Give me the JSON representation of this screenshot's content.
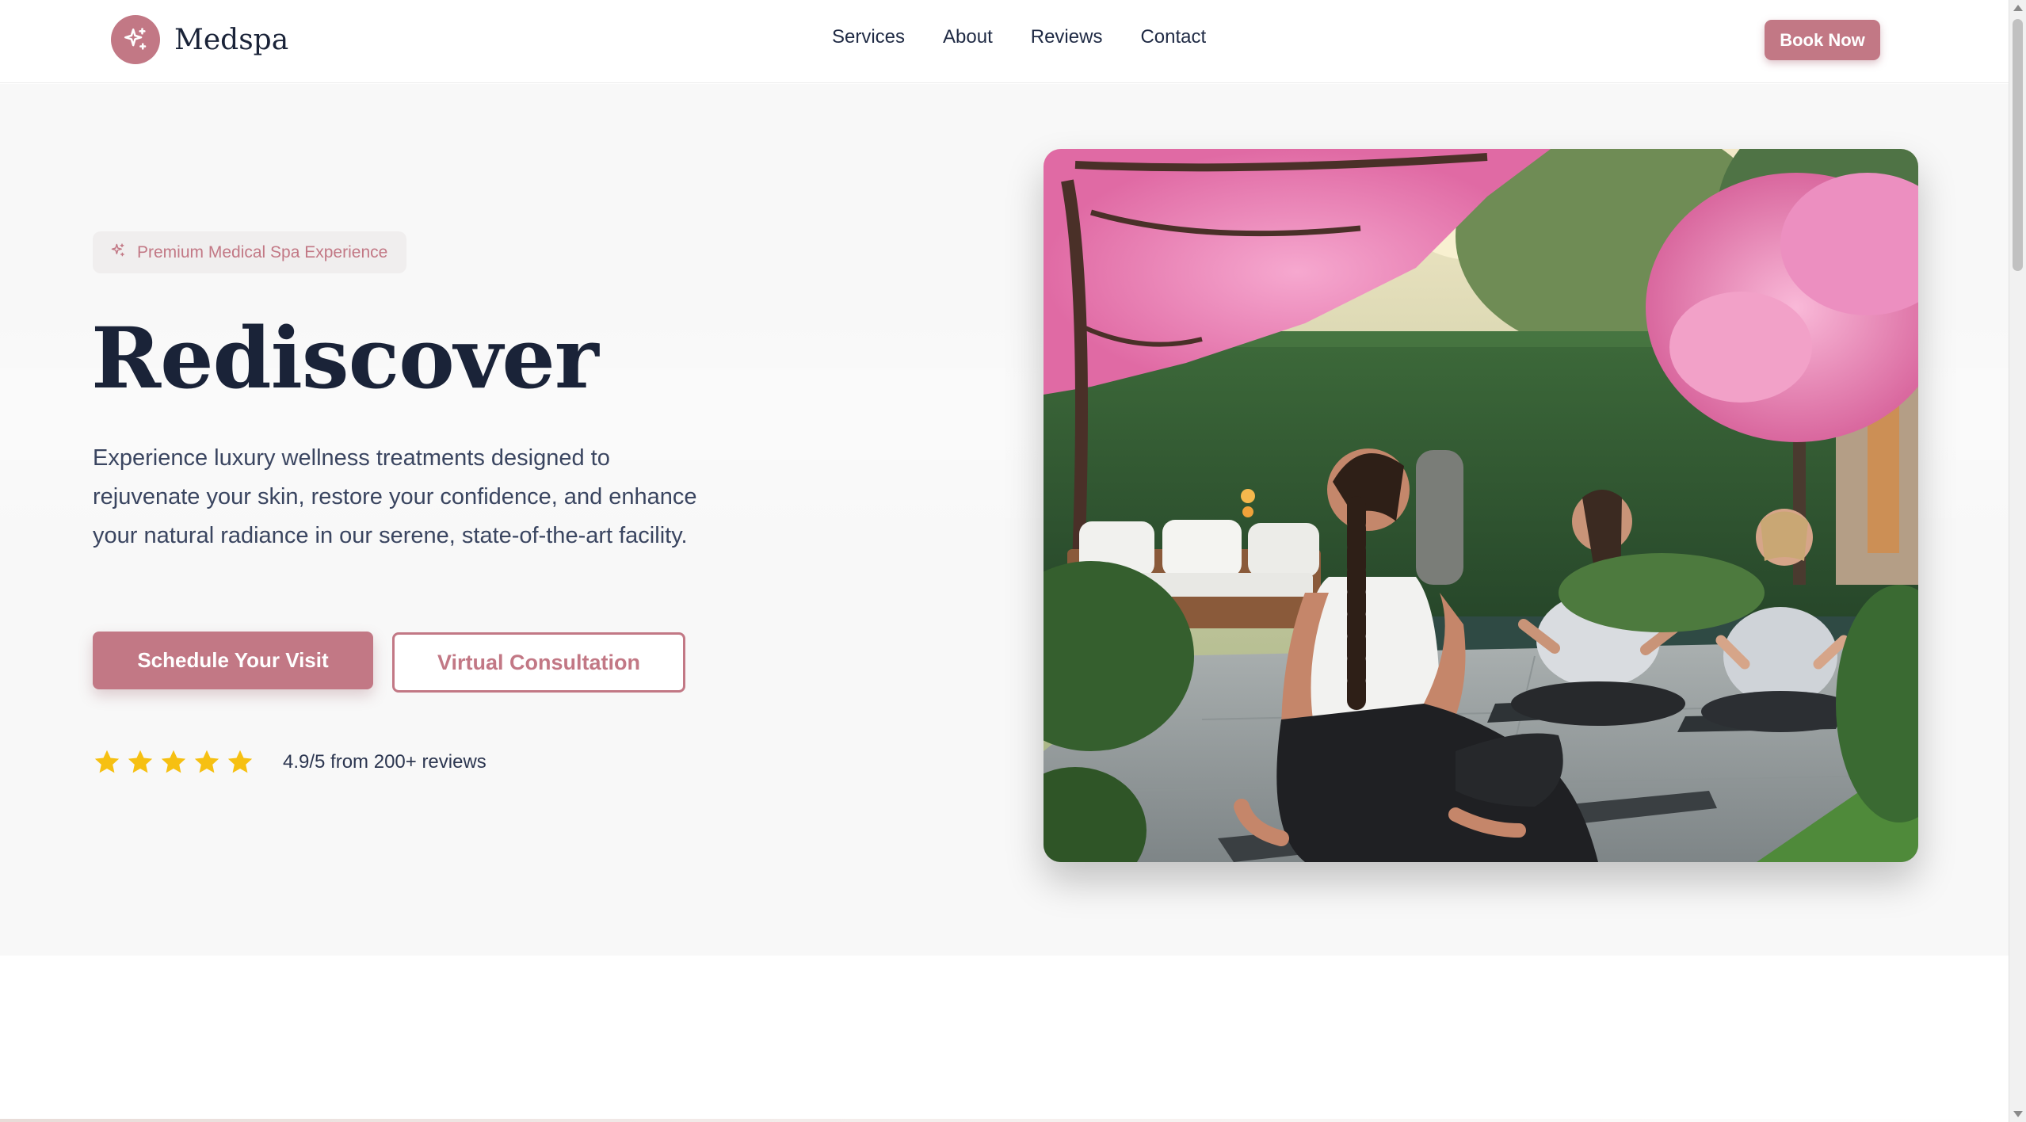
{
  "brand": {
    "name": "Medspa",
    "logo_icon": "sparkle-icon",
    "accent_color": "#c27885",
    "dark_color": "#1a2338"
  },
  "nav": {
    "items": [
      {
        "label": "Services"
      },
      {
        "label": "About"
      },
      {
        "label": "Reviews"
      },
      {
        "label": "Contact"
      }
    ],
    "cta_label": "Book Now"
  },
  "hero": {
    "badge_icon": "sparkle-icon",
    "badge_text": "Premium Medical Spa Experience",
    "title": "Rediscover",
    "description": "Experience luxury wellness treatments designed to rejuvenate your skin, restore your confidence, and enhance your natural radiance in our serene, state-of-the-art facility.",
    "primary_cta": "Schedule Your Visit",
    "secondary_cta": "Virtual Consultation",
    "rating": {
      "stars": 5,
      "star_color": "#f6c012",
      "text": "4.9/5 from 200+ reviews"
    }
  }
}
